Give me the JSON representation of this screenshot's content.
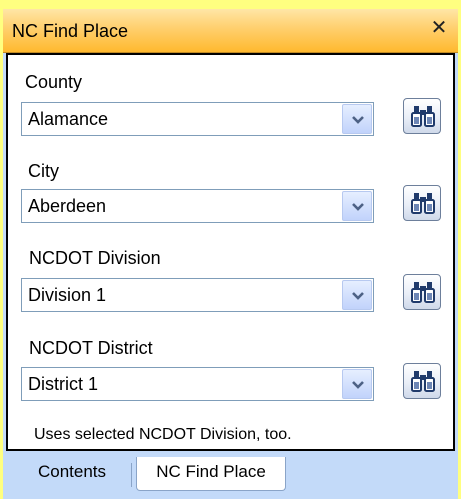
{
  "window": {
    "title": "NC Find Place",
    "close_glyph": "✕"
  },
  "fields": [
    {
      "label": "County",
      "value": "Alamance"
    },
    {
      "label": "City",
      "value": "Aberdeen"
    },
    {
      "label": "NCDOT Division",
      "value": "Division 1"
    },
    {
      "label": "NCDOT District",
      "value": "District 1"
    }
  ],
  "note": "Uses selected NCDOT Division, too.",
  "tabs": [
    {
      "label": "Contents",
      "active": false
    },
    {
      "label": "NC Find Place",
      "active": true
    }
  ],
  "icons": {
    "dropdown": "chevron-down-icon",
    "find": "binoculars-icon"
  },
  "colors": {
    "title_gradient_top": "#ffe6a6",
    "title_gradient_bottom": "#ffb92e",
    "panel_background": "#c3daf9",
    "outer_background": "#ffff80"
  }
}
